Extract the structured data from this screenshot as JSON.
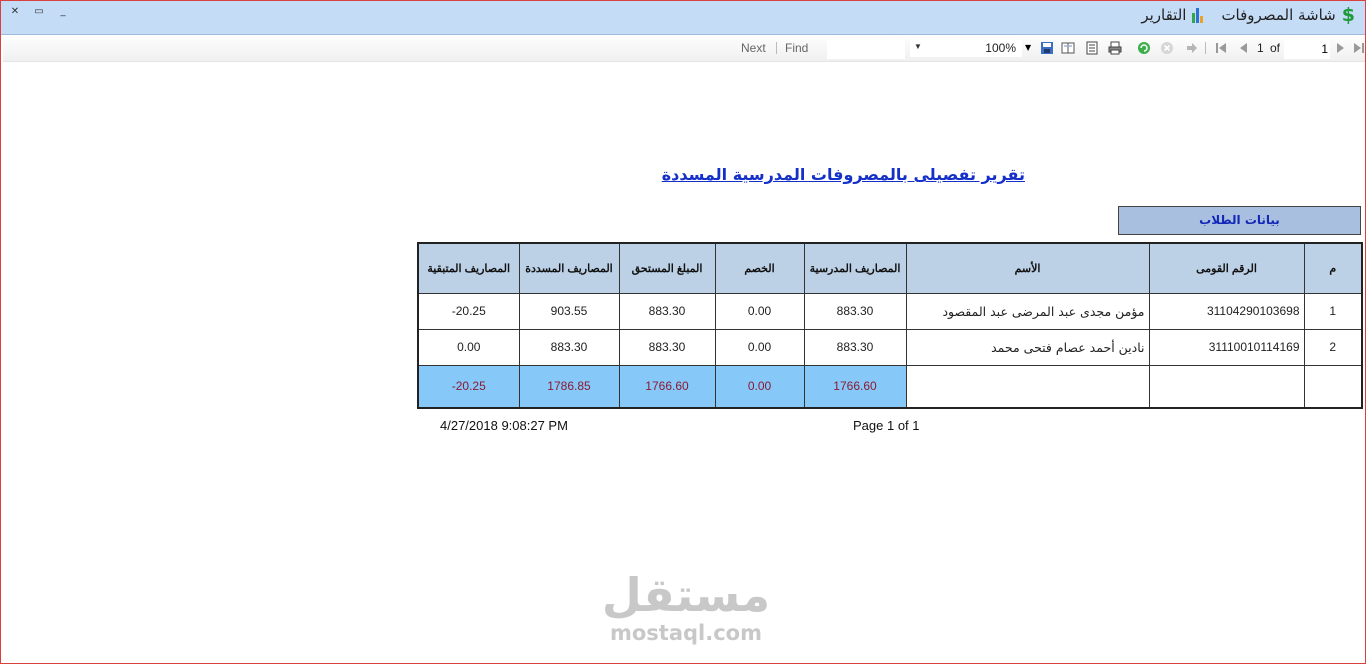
{
  "window": {
    "controls": {
      "close": "✕",
      "maximize": "▭",
      "minimize": "_"
    },
    "menu": [
      {
        "label": "شاشة المصروفات",
        "icon": "dollar-icon"
      },
      {
        "label": "التقارير",
        "icon": "bar-chart-icon"
      }
    ]
  },
  "toolbar": {
    "next_label": "Next",
    "find_label": "Find",
    "find_value": "",
    "zoom": "100%",
    "page_current": "1",
    "page_of": "of",
    "page_total": "1",
    "icons": [
      "export-icon",
      "document-map-icon",
      "page-setup-icon",
      "print-layout-icon",
      "print-icon",
      "refresh-icon",
      "stop-icon",
      "back-icon",
      "first-page-icon",
      "previous-page-icon",
      "next-page-icon",
      "last-page-icon"
    ]
  },
  "report": {
    "title": "تقرير تفصيلى بالمصروفات المدرسية المسددة",
    "section_label": "بيانات الطلاب",
    "columns": [
      "م",
      "الرقم القومى",
      "الأسم",
      "المصاريف المدرسية",
      "الخصم",
      "المبلغ المستحق",
      "المصاريف المسددة",
      "المصاريف المتبقية"
    ],
    "rows": [
      {
        "index": "1",
        "national_id": "31104290103698",
        "name": "مؤمن مجدى عبد المرضى عبد المقصود",
        "fees": "883.30",
        "discount": "0.00",
        "due": "883.30",
        "paid": "903.55",
        "remaining": "-20.25"
      },
      {
        "index": "2",
        "national_id": "31110010114169",
        "name": "نادين أحمد عصام فتحى محمد",
        "fees": "883.30",
        "discount": "0.00",
        "due": "883.30",
        "paid": "883.30",
        "remaining": "0.00"
      }
    ],
    "totals": {
      "fees": "1766.60",
      "discount": "0.00",
      "due": "1766.60",
      "paid": "1786.85",
      "remaining": "-20.25"
    },
    "footer_date": "4/27/2018 9:08:27 PM",
    "footer_page": "Page 1 of 1"
  },
  "watermark": {
    "arabic": "مستقل",
    "latin": "mostaql.com"
  },
  "colors": {
    "accent_header": "#c5dcf7",
    "title_blue": "#1530c9",
    "total_highlight": "#86c8f7",
    "total_text": "#8a1a35"
  }
}
